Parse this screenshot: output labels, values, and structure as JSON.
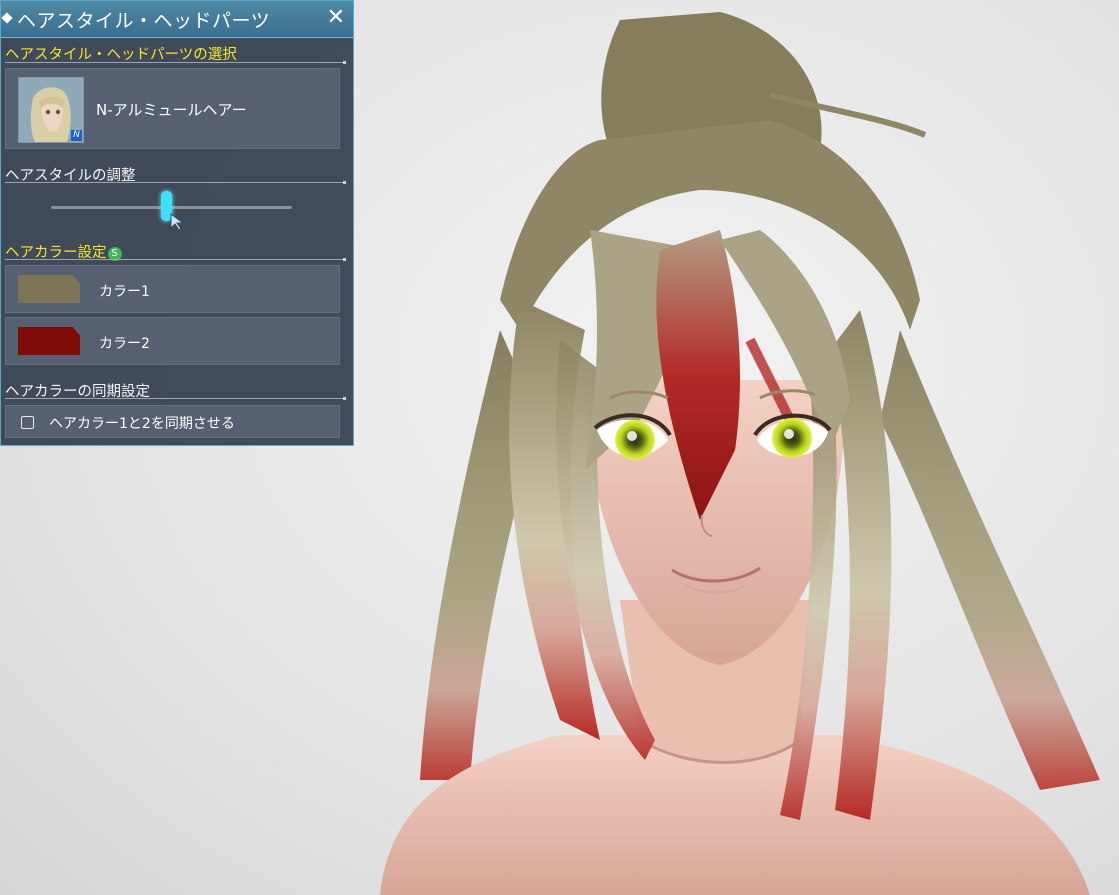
{
  "panel": {
    "title": "ヘアスタイル・ヘッドパーツ",
    "close_glyph": "✕",
    "hairstyle_select": {
      "label": "ヘアスタイル・ヘッドパーツの選択",
      "selected_name": "N-アルミュールヘアー",
      "badge": "N"
    },
    "hairstyle_adjust": {
      "label": "ヘアスタイルの調整",
      "slider_value": 0.48
    },
    "hair_color": {
      "label": "ヘアカラー設定",
      "badge": "S",
      "colors": [
        {
          "label": "カラー1",
          "hex": "#7d7456"
        },
        {
          "label": "カラー2",
          "hex": "#7e0a0a"
        }
      ]
    },
    "sync": {
      "label": "ヘアカラーの同期設定",
      "checkbox_label": "ヘアカラー1と2を同期させる",
      "checked": false
    }
  },
  "colors": {
    "panel_bg": "#343e4e",
    "titlebar": "#3b6f8d",
    "accent_yellow": "#f4e531",
    "slider_thumb": "#3fe0ff"
  }
}
